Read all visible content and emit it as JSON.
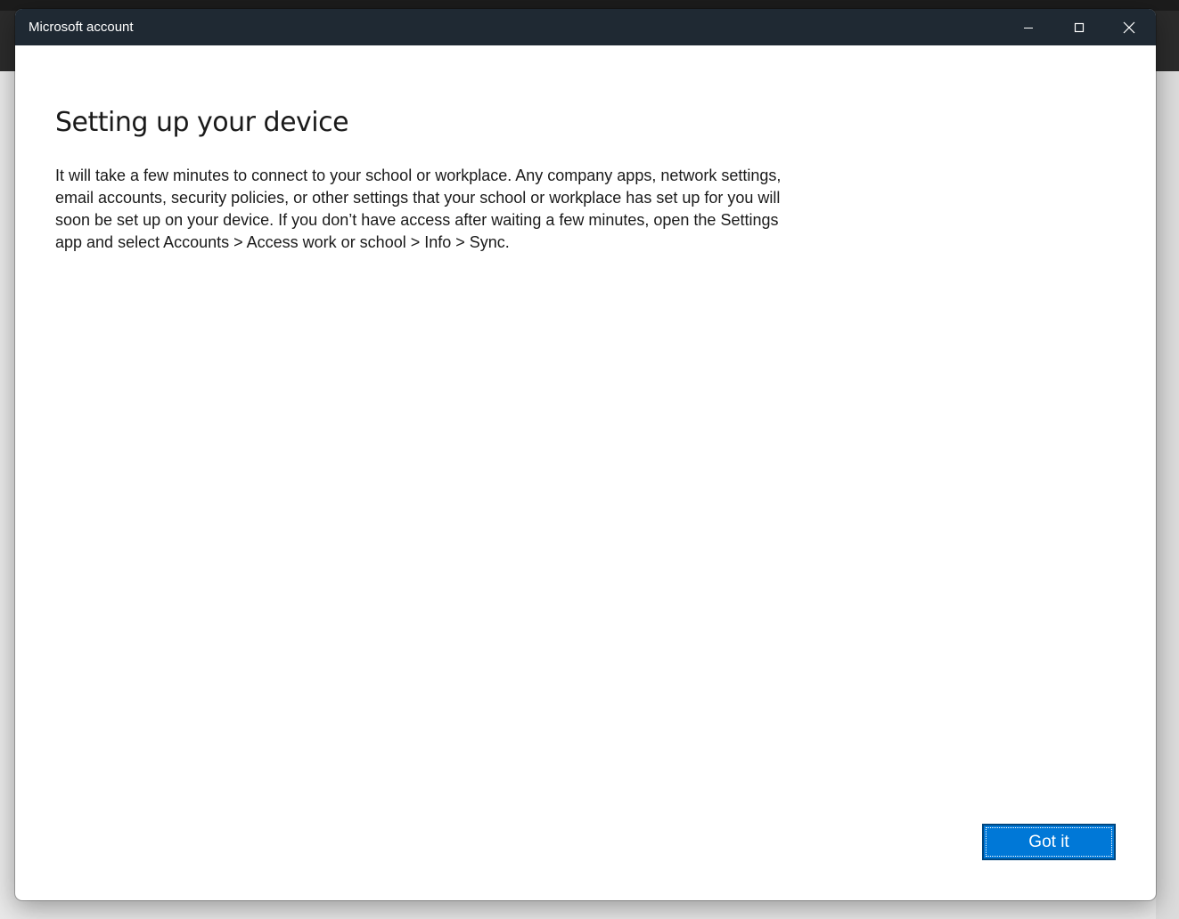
{
  "window": {
    "title": "Microsoft account",
    "titlebar_color": "#1f2933"
  },
  "caption_buttons": {
    "minimize_icon": "minimize-icon",
    "maximize_icon": "maximize-icon",
    "close_icon": "close-icon"
  },
  "main": {
    "heading": "Setting up your device",
    "body": "It will take a few minutes to connect to your school or workplace. Any company apps, network settings, email accounts, security policies, or other settings that your school or workplace has set up for you will soon be set up on your device. If you don’t have access after waiting a few minutes, open the Settings app and select Accounts > Access work or school > Info > Sync."
  },
  "footer": {
    "got_it_label": "Got it",
    "accent_color": "#0078d7"
  }
}
